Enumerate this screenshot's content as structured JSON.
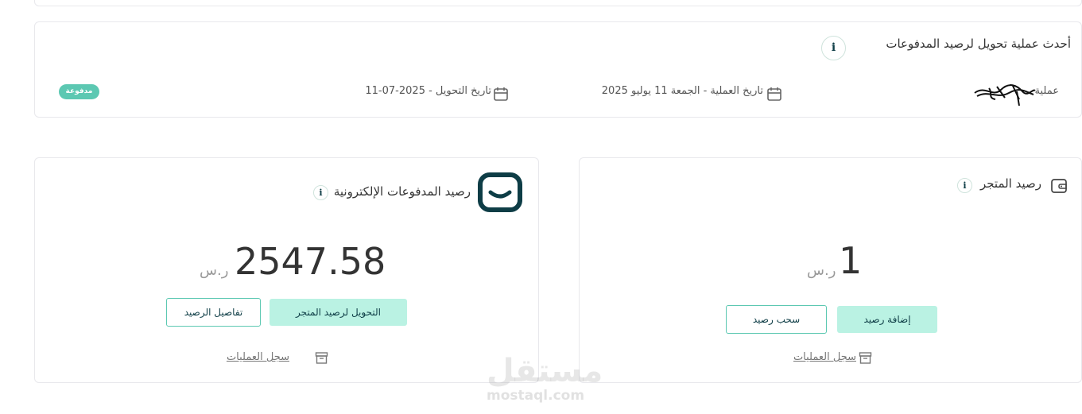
{
  "latest_transfer": {
    "title": "أحدث عملية تحويل لرصيد المدفوعات",
    "operation_label": "عملية",
    "operation_date": "تاريخ العملية - الجمعة 11 يوليو 2025",
    "transfer_date": "تاريخ التحويل - 2025-07-11",
    "status_badge": "مدفوعة"
  },
  "payments_balance": {
    "title": "رصيد المدفوعات الإلكترونية",
    "amount": "2547.58",
    "currency": "ر.س",
    "transfer_button": "التحويل لرصيد المتجر",
    "details_button": "تفاصيل الرصيد",
    "history_link": "سجل العمليات"
  },
  "store_balance": {
    "title": "رصيد المتجر",
    "amount": "1",
    "currency": "ر.س",
    "add_button": "إضافة رصيد",
    "withdraw_button": "سحب رصيد",
    "history_link": "سجل العمليات"
  },
  "info_icon_glyph": "i",
  "watermark": {
    "arabic": "مستقل",
    "latin": "mostaql.com"
  },
  "colors": {
    "accent": "#baf2e3",
    "accent_border": "#5cc8b2",
    "brand_dark": "#0e3d46"
  },
  "icons": [
    "info-icon",
    "calendar-icon",
    "wallet-icon",
    "payments-logo-icon",
    "archive-icon"
  ]
}
